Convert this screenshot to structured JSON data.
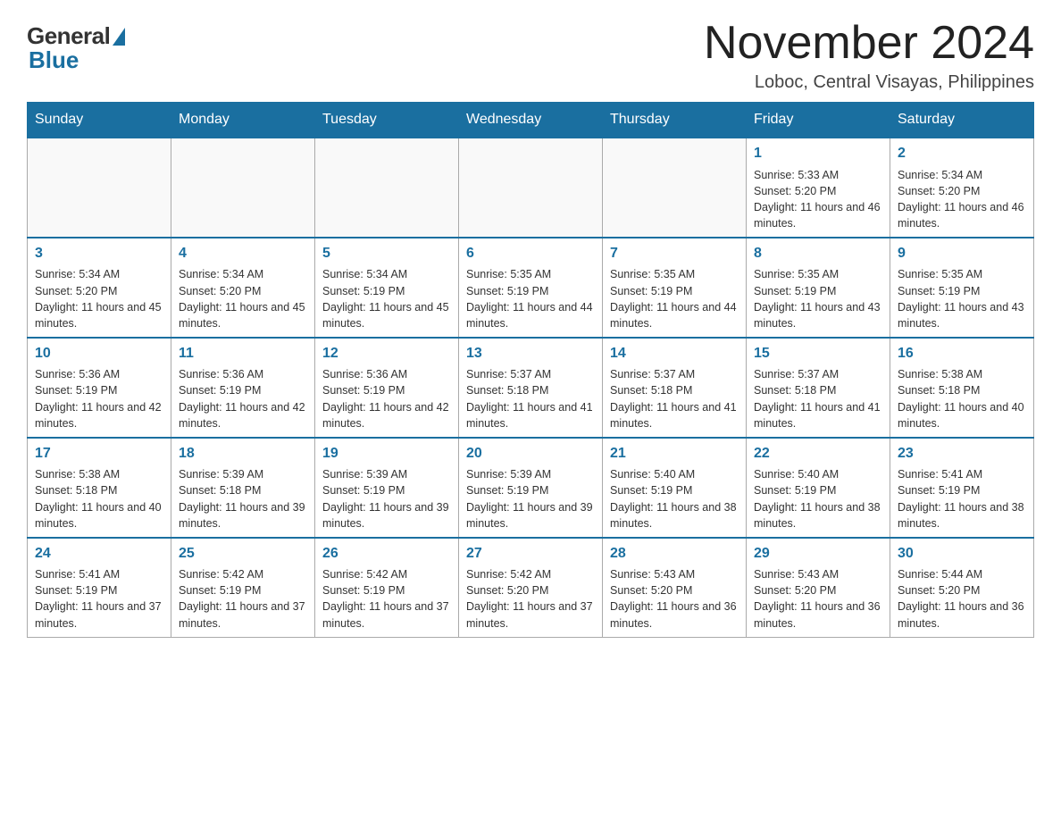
{
  "header": {
    "logo_general": "General",
    "logo_blue": "Blue",
    "month_title": "November 2024",
    "location": "Loboc, Central Visayas, Philippines"
  },
  "days_of_week": [
    "Sunday",
    "Monday",
    "Tuesday",
    "Wednesday",
    "Thursday",
    "Friday",
    "Saturday"
  ],
  "weeks": [
    [
      {
        "day": "",
        "info": ""
      },
      {
        "day": "",
        "info": ""
      },
      {
        "day": "",
        "info": ""
      },
      {
        "day": "",
        "info": ""
      },
      {
        "day": "",
        "info": ""
      },
      {
        "day": "1",
        "info": "Sunrise: 5:33 AM\nSunset: 5:20 PM\nDaylight: 11 hours and 46 minutes."
      },
      {
        "day": "2",
        "info": "Sunrise: 5:34 AM\nSunset: 5:20 PM\nDaylight: 11 hours and 46 minutes."
      }
    ],
    [
      {
        "day": "3",
        "info": "Sunrise: 5:34 AM\nSunset: 5:20 PM\nDaylight: 11 hours and 45 minutes."
      },
      {
        "day": "4",
        "info": "Sunrise: 5:34 AM\nSunset: 5:20 PM\nDaylight: 11 hours and 45 minutes."
      },
      {
        "day": "5",
        "info": "Sunrise: 5:34 AM\nSunset: 5:19 PM\nDaylight: 11 hours and 45 minutes."
      },
      {
        "day": "6",
        "info": "Sunrise: 5:35 AM\nSunset: 5:19 PM\nDaylight: 11 hours and 44 minutes."
      },
      {
        "day": "7",
        "info": "Sunrise: 5:35 AM\nSunset: 5:19 PM\nDaylight: 11 hours and 44 minutes."
      },
      {
        "day": "8",
        "info": "Sunrise: 5:35 AM\nSunset: 5:19 PM\nDaylight: 11 hours and 43 minutes."
      },
      {
        "day": "9",
        "info": "Sunrise: 5:35 AM\nSunset: 5:19 PM\nDaylight: 11 hours and 43 minutes."
      }
    ],
    [
      {
        "day": "10",
        "info": "Sunrise: 5:36 AM\nSunset: 5:19 PM\nDaylight: 11 hours and 42 minutes."
      },
      {
        "day": "11",
        "info": "Sunrise: 5:36 AM\nSunset: 5:19 PM\nDaylight: 11 hours and 42 minutes."
      },
      {
        "day": "12",
        "info": "Sunrise: 5:36 AM\nSunset: 5:19 PM\nDaylight: 11 hours and 42 minutes."
      },
      {
        "day": "13",
        "info": "Sunrise: 5:37 AM\nSunset: 5:18 PM\nDaylight: 11 hours and 41 minutes."
      },
      {
        "day": "14",
        "info": "Sunrise: 5:37 AM\nSunset: 5:18 PM\nDaylight: 11 hours and 41 minutes."
      },
      {
        "day": "15",
        "info": "Sunrise: 5:37 AM\nSunset: 5:18 PM\nDaylight: 11 hours and 41 minutes."
      },
      {
        "day": "16",
        "info": "Sunrise: 5:38 AM\nSunset: 5:18 PM\nDaylight: 11 hours and 40 minutes."
      }
    ],
    [
      {
        "day": "17",
        "info": "Sunrise: 5:38 AM\nSunset: 5:18 PM\nDaylight: 11 hours and 40 minutes."
      },
      {
        "day": "18",
        "info": "Sunrise: 5:39 AM\nSunset: 5:18 PM\nDaylight: 11 hours and 39 minutes."
      },
      {
        "day": "19",
        "info": "Sunrise: 5:39 AM\nSunset: 5:19 PM\nDaylight: 11 hours and 39 minutes."
      },
      {
        "day": "20",
        "info": "Sunrise: 5:39 AM\nSunset: 5:19 PM\nDaylight: 11 hours and 39 minutes."
      },
      {
        "day": "21",
        "info": "Sunrise: 5:40 AM\nSunset: 5:19 PM\nDaylight: 11 hours and 38 minutes."
      },
      {
        "day": "22",
        "info": "Sunrise: 5:40 AM\nSunset: 5:19 PM\nDaylight: 11 hours and 38 minutes."
      },
      {
        "day": "23",
        "info": "Sunrise: 5:41 AM\nSunset: 5:19 PM\nDaylight: 11 hours and 38 minutes."
      }
    ],
    [
      {
        "day": "24",
        "info": "Sunrise: 5:41 AM\nSunset: 5:19 PM\nDaylight: 11 hours and 37 minutes."
      },
      {
        "day": "25",
        "info": "Sunrise: 5:42 AM\nSunset: 5:19 PM\nDaylight: 11 hours and 37 minutes."
      },
      {
        "day": "26",
        "info": "Sunrise: 5:42 AM\nSunset: 5:19 PM\nDaylight: 11 hours and 37 minutes."
      },
      {
        "day": "27",
        "info": "Sunrise: 5:42 AM\nSunset: 5:20 PM\nDaylight: 11 hours and 37 minutes."
      },
      {
        "day": "28",
        "info": "Sunrise: 5:43 AM\nSunset: 5:20 PM\nDaylight: 11 hours and 36 minutes."
      },
      {
        "day": "29",
        "info": "Sunrise: 5:43 AM\nSunset: 5:20 PM\nDaylight: 11 hours and 36 minutes."
      },
      {
        "day": "30",
        "info": "Sunrise: 5:44 AM\nSunset: 5:20 PM\nDaylight: 11 hours and 36 minutes."
      }
    ]
  ]
}
